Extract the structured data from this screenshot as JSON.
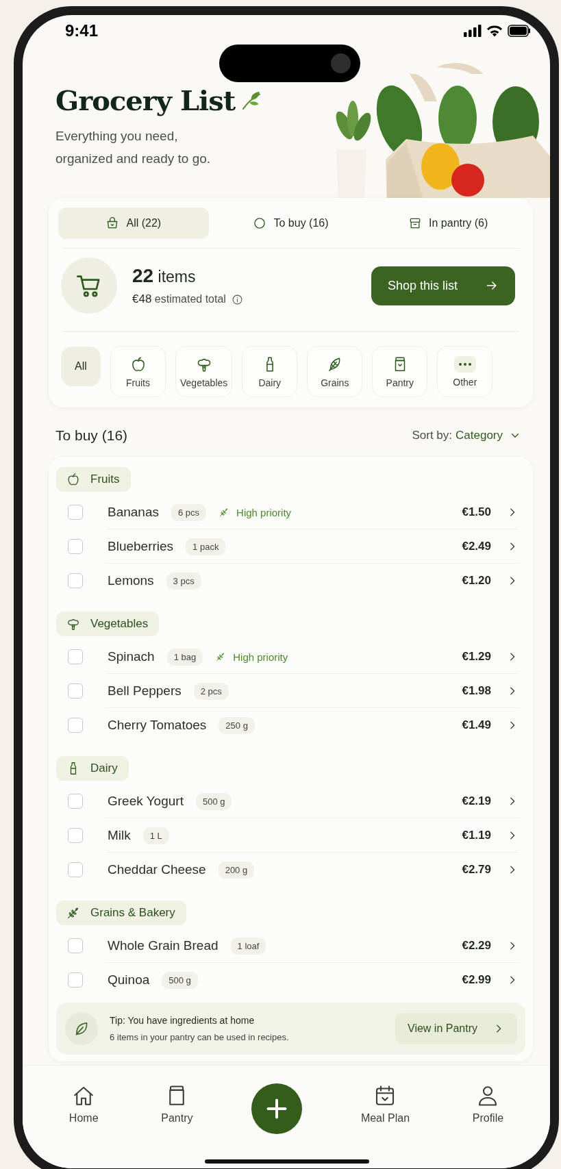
{
  "status_bar": {
    "time": "9:41"
  },
  "header": {
    "title": "Grocery List",
    "subtitle": "Everything you need, organized and ready to go."
  },
  "filter_tabs": [
    {
      "label": "All (22)",
      "selected": true
    },
    {
      "label": "To buy (16)",
      "selected": false
    },
    {
      "label": "In pantry (6)",
      "selected": false
    }
  ],
  "summary": {
    "count": "22",
    "count_unit": "items",
    "total": "€48",
    "total_label": "estimated total",
    "button": "Shop this list"
  },
  "categories": [
    {
      "label": "All",
      "selected": true
    },
    {
      "label": "Fruits",
      "selected": false
    },
    {
      "label": "Vegetables",
      "selected": false
    },
    {
      "label": "Dairy",
      "selected": false
    },
    {
      "label": "Grains",
      "selected": false
    },
    {
      "label": "Pantry",
      "selected": false
    },
    {
      "label": "Other",
      "selected": false
    }
  ],
  "list": {
    "title": "To buy (16)",
    "sort_label": "Sort by:",
    "sort_value": "Category"
  },
  "groups": [
    {
      "name": "Fruits",
      "items": [
        {
          "name": "Bananas",
          "qty": "6 pcs",
          "priority": "High priority",
          "price": "€1.50",
          "checked": false
        },
        {
          "name": "Blueberries",
          "qty": "1 pack",
          "price": "€2.49",
          "checked": false
        },
        {
          "name": "Lemons",
          "qty": "3 pcs",
          "price": "€1.20",
          "checked": false
        }
      ]
    },
    {
      "name": "Vegetables",
      "items": [
        {
          "name": "Spinach",
          "qty": "1 bag",
          "priority": "High priority",
          "price": "€1.29",
          "checked": false
        },
        {
          "name": "Bell Peppers",
          "qty": "2 pcs",
          "price": "€1.98",
          "checked": false
        },
        {
          "name": "Cherry Tomatoes",
          "qty": "250 g",
          "price": "€1.49",
          "checked": false
        }
      ]
    },
    {
      "name": "Dairy",
      "items": [
        {
          "name": "Greek Yogurt",
          "qty": "500 g",
          "price": "€2.19",
          "checked": false
        },
        {
          "name": "Milk",
          "qty": "1 L",
          "price": "€1.19",
          "checked": false
        },
        {
          "name": "Cheddar Cheese",
          "qty": "200 g",
          "price": "€2.79",
          "checked": false
        }
      ]
    },
    {
      "name": "Grains & Bakery",
      "items": [
        {
          "name": "Whole Grain Bread",
          "qty": "1 loaf",
          "price": "€2.29",
          "checked": false
        },
        {
          "name": "Quinoa",
          "qty": "500 g",
          "price": "€2.99",
          "checked": false
        }
      ]
    }
  ],
  "tip": {
    "title": "Tip: You have ingredients at home",
    "text": "6 items in your pantry can be used in recipes.",
    "button": "View in Pantry"
  },
  "nav": [
    {
      "kind": "tab",
      "label": "Home"
    },
    {
      "kind": "tab",
      "label": "Pantry"
    },
    {
      "kind": "add"
    },
    {
      "kind": "tab",
      "label": "Meal Plan"
    },
    {
      "kind": "tab",
      "label": "Profile"
    }
  ]
}
